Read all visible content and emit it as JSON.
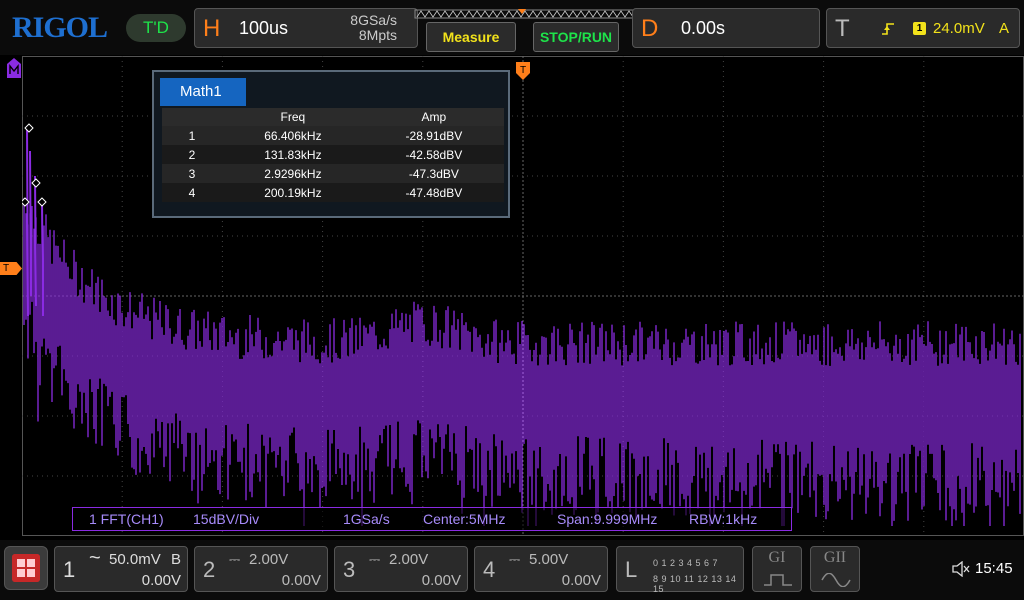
{
  "brand": {
    "logo": "RIGOL",
    "status": "T'D"
  },
  "horizontal": {
    "letter": "H",
    "timebase": "100us",
    "sample_rate": "8GSa/s",
    "memory_depth": "8Mpts"
  },
  "buttons": {
    "measure": "Measure",
    "stop_run": "STOP/RUN"
  },
  "delay": {
    "letter": "D",
    "value": "0.00s"
  },
  "trigger": {
    "letter": "T",
    "channel": "1",
    "level": "24.0mV",
    "mode": "A"
  },
  "markers": {
    "trigger_level": "T"
  },
  "math_window": {
    "tab": "Math1",
    "columns": [
      "",
      "Freq",
      "Amp"
    ],
    "rows": [
      {
        "index": "1",
        "freq": "66.406kHz",
        "amp": "-28.91dBV"
      },
      {
        "index": "2",
        "freq": "131.83kHz",
        "amp": "-42.58dBV"
      },
      {
        "index": "3",
        "freq": "2.9296kHz",
        "amp": "-47.3dBV"
      },
      {
        "index": "4",
        "freq": "200.19kHz",
        "amp": "-47.48dBV"
      }
    ]
  },
  "fft_info": {
    "source": "1 FFT(CH1)",
    "scale": "15dBV/Div",
    "sample_rate": "1GSa/s",
    "center": "Center:5MHz",
    "span": "Span:9.999MHz",
    "rbw": "RBW:1kHz"
  },
  "channels": [
    {
      "num": "1",
      "coupling": "~",
      "volts": "50.0mV",
      "bw": "B",
      "offset": "0.00V"
    },
    {
      "num": "2",
      "coupling": "⎓",
      "volts": "2.00V",
      "bw": "",
      "offset": "0.00V"
    },
    {
      "num": "3",
      "coupling": "⎓",
      "volts": "2.00V",
      "bw": "",
      "offset": "0.00V"
    },
    {
      "num": "4",
      "coupling": "⎓",
      "volts": "5.00V",
      "bw": "",
      "offset": "0.00V"
    }
  ],
  "logic": {
    "letter": "L",
    "row1": "0 1 2 3   4 5 6 7",
    "row2": "8 9 10 11  12 13 14 15"
  },
  "generators": {
    "g1": "GI",
    "g2": "GII"
  },
  "status": {
    "time": "15:45"
  },
  "colors": {
    "math_trace": "#8a2be2",
    "accent": "#ff7f1a",
    "trigger": "#f2e21b",
    "run": "#1ee34a"
  }
}
